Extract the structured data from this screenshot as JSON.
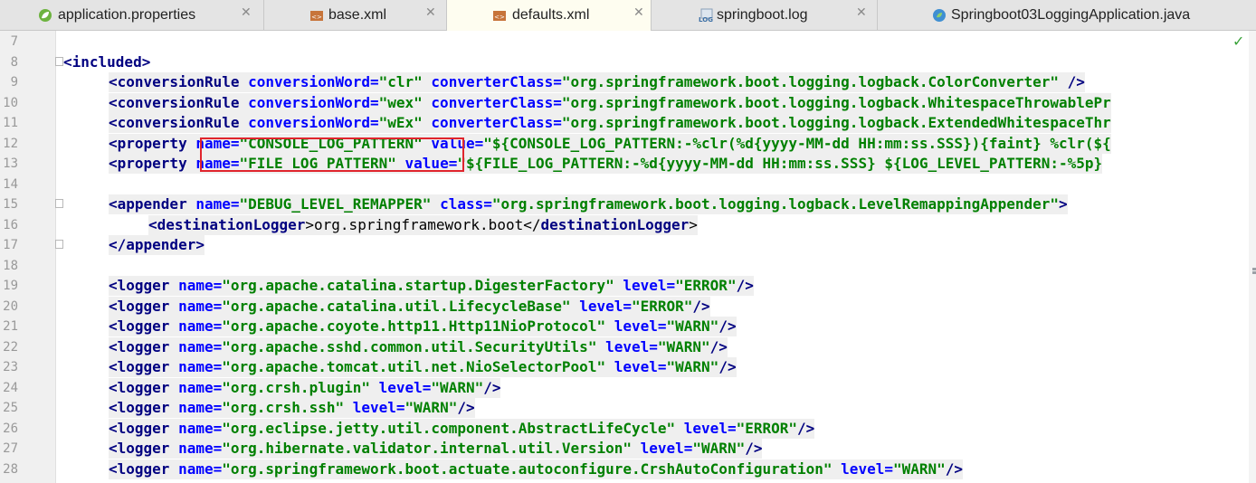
{
  "tabs": [
    {
      "label": "application.properties",
      "icon": "spring-leaf-icon"
    },
    {
      "label": "base.xml",
      "icon": "xml-file-icon"
    },
    {
      "label": "defaults.xml",
      "icon": "xml-file-icon",
      "active": true
    },
    {
      "label": "springboot.log",
      "icon": "log-file-icon"
    },
    {
      "label": "Springboot03LoggingApplication.java",
      "icon": "spring-class-icon"
    }
  ],
  "close_glyph": "✕",
  "status_check": "✓",
  "line_numbers": [
    "7",
    "8",
    "9",
    "10",
    "11",
    "12",
    "13",
    "14",
    "15",
    "16",
    "17",
    "18",
    "19",
    "20",
    "21",
    "22",
    "23",
    "24",
    "25",
    "26",
    "27",
    "28"
  ],
  "code_lines": [
    [],
    [
      {
        "t": "tag",
        "v": "<included>"
      }
    ],
    [
      {
        "t": "tag",
        "v": "<conversionRule "
      },
      {
        "t": "attr",
        "v": "conversionWord="
      },
      {
        "t": "val",
        "v": "\"clr\" "
      },
      {
        "t": "attr",
        "v": "converterClass="
      },
      {
        "t": "val",
        "v": "\"org.springframework.boot.logging.logback.ColorConverter\" "
      },
      {
        "t": "tag",
        "v": "/>"
      }
    ],
    [
      {
        "t": "tag",
        "v": "<conversionRule "
      },
      {
        "t": "attr",
        "v": "conversionWord="
      },
      {
        "t": "val",
        "v": "\"wex\" "
      },
      {
        "t": "attr",
        "v": "converterClass="
      },
      {
        "t": "val",
        "v": "\"org.springframework.boot.logging.logback.WhitespaceThrowablePr"
      }
    ],
    [
      {
        "t": "tag",
        "v": "<conversionRule "
      },
      {
        "t": "attr",
        "v": "conversionWord="
      },
      {
        "t": "val",
        "v": "\"wEx\" "
      },
      {
        "t": "attr",
        "v": "converterClass="
      },
      {
        "t": "val",
        "v": "\"org.springframework.boot.logging.logback.ExtendedWhitespaceThr"
      }
    ],
    [
      {
        "t": "tag",
        "v": "<property "
      },
      {
        "t": "attr",
        "v": "name="
      },
      {
        "t": "val",
        "v": "\"CONSOLE_LOG_PATTERN\" "
      },
      {
        "t": "attr",
        "v": "value="
      },
      {
        "t": "val",
        "v": "\"${CONSOLE_LOG_PATTERN:-%clr(%d{yyyy-MM-dd HH:mm:ss.SSS}){faint} %clr(${"
      }
    ],
    [
      {
        "t": "tag",
        "v": "<property "
      },
      {
        "t": "attr",
        "v": "name="
      },
      {
        "t": "val",
        "v": "\"FILE_LOG_PATTERN\" "
      },
      {
        "t": "attr",
        "v": "value="
      },
      {
        "t": "val",
        "v": "\"${FILE_LOG_PATTERN:-%d{yyyy-MM-dd HH:mm:ss.SSS} ${LOG_LEVEL_PATTERN:-%5p}"
      }
    ],
    [],
    [
      {
        "t": "tag",
        "v": "<appender "
      },
      {
        "t": "attr",
        "v": "name="
      },
      {
        "t": "val",
        "v": "\"DEBUG_LEVEL_REMAPPER\" "
      },
      {
        "t": "attr",
        "v": "class="
      },
      {
        "t": "val",
        "v": "\"org.springframework.boot.logging.logback.LevelRemappingAppender\""
      },
      {
        "t": "tag",
        "v": ">"
      }
    ],
    [
      {
        "t": "tag",
        "v": "<destinationLogger"
      },
      {
        "t": "txt",
        "v": ">org.springframework.boot</"
      },
      {
        "t": "tag",
        "v": "destinationLogger"
      },
      {
        "t": "txt",
        "v": ">"
      }
    ],
    [
      {
        "t": "tag",
        "v": "</appender>"
      }
    ],
    [],
    [
      {
        "t": "tag",
        "v": "<logger "
      },
      {
        "t": "attr",
        "v": "name="
      },
      {
        "t": "val",
        "v": "\"org.apache.catalina.startup.DigesterFactory\" "
      },
      {
        "t": "attr",
        "v": "level="
      },
      {
        "t": "val",
        "v": "\"ERROR\""
      },
      {
        "t": "tag",
        "v": "/>"
      }
    ],
    [
      {
        "t": "tag",
        "v": "<logger "
      },
      {
        "t": "attr",
        "v": "name="
      },
      {
        "t": "val",
        "v": "\"org.apache.catalina.util.LifecycleBase\" "
      },
      {
        "t": "attr",
        "v": "level="
      },
      {
        "t": "val",
        "v": "\"ERROR\""
      },
      {
        "t": "tag",
        "v": "/>"
      }
    ],
    [
      {
        "t": "tag",
        "v": "<logger "
      },
      {
        "t": "attr",
        "v": "name="
      },
      {
        "t": "val",
        "v": "\"org.apache.coyote.http11.Http11NioProtocol\" "
      },
      {
        "t": "attr",
        "v": "level="
      },
      {
        "t": "val",
        "v": "\"WARN\""
      },
      {
        "t": "tag",
        "v": "/>"
      }
    ],
    [
      {
        "t": "tag",
        "v": "<logger "
      },
      {
        "t": "attr",
        "v": "name="
      },
      {
        "t": "val",
        "v": "\"org.apache.sshd.common.util.SecurityUtils\" "
      },
      {
        "t": "attr",
        "v": "level="
      },
      {
        "t": "val",
        "v": "\"WARN\""
      },
      {
        "t": "tag",
        "v": "/>"
      }
    ],
    [
      {
        "t": "tag",
        "v": "<logger "
      },
      {
        "t": "attr",
        "v": "name="
      },
      {
        "t": "val",
        "v": "\"org.apache.tomcat.util.net.NioSelectorPool\" "
      },
      {
        "t": "attr",
        "v": "level="
      },
      {
        "t": "val",
        "v": "\"WARN\""
      },
      {
        "t": "tag",
        "v": "/>"
      }
    ],
    [
      {
        "t": "tag",
        "v": "<logger "
      },
      {
        "t": "attr",
        "v": "name="
      },
      {
        "t": "val",
        "v": "\"org.crsh.plugin\" "
      },
      {
        "t": "attr",
        "v": "level="
      },
      {
        "t": "val",
        "v": "\"WARN\""
      },
      {
        "t": "tag",
        "v": "/>"
      }
    ],
    [
      {
        "t": "tag",
        "v": "<logger "
      },
      {
        "t": "attr",
        "v": "name="
      },
      {
        "t": "val",
        "v": "\"org.crsh.ssh\" "
      },
      {
        "t": "attr",
        "v": "level="
      },
      {
        "t": "val",
        "v": "\"WARN\""
      },
      {
        "t": "tag",
        "v": "/>"
      }
    ],
    [
      {
        "t": "tag",
        "v": "<logger "
      },
      {
        "t": "attr",
        "v": "name="
      },
      {
        "t": "val",
        "v": "\"org.eclipse.jetty.util.component.AbstractLifeCycle\" "
      },
      {
        "t": "attr",
        "v": "level="
      },
      {
        "t": "val",
        "v": "\"ERROR\""
      },
      {
        "t": "tag",
        "v": "/>"
      }
    ],
    [
      {
        "t": "tag",
        "v": "<logger "
      },
      {
        "t": "attr",
        "v": "name="
      },
      {
        "t": "val",
        "v": "\"org.hibernate.validator.internal.util.Version\" "
      },
      {
        "t": "attr",
        "v": "level="
      },
      {
        "t": "val",
        "v": "\"WARN\""
      },
      {
        "t": "tag",
        "v": "/>"
      }
    ],
    [
      {
        "t": "tag",
        "v": "<logger "
      },
      {
        "t": "attr",
        "v": "name="
      },
      {
        "t": "val",
        "v": "\"org.springframework.boot.actuate.autoconfigure.CrshAutoConfiguration\" "
      },
      {
        "t": "attr",
        "v": "level="
      },
      {
        "t": "val",
        "v": "\"WARN\""
      },
      {
        "t": "tag",
        "v": "/>"
      }
    ]
  ]
}
